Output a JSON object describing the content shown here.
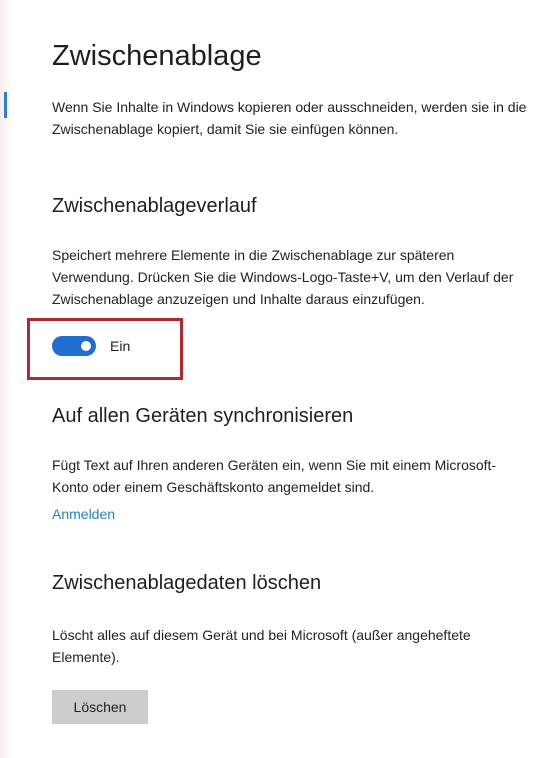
{
  "page": {
    "title": "Zwischenablage",
    "intro": "Wenn Sie Inhalte in Windows kopieren oder ausschneiden, werden sie in die Zwischenablage kopiert, damit Sie sie einfügen können."
  },
  "history": {
    "title": "Zwischenablageverlauf",
    "description": "Speichert mehrere Elemente in die Zwischenablage zur späteren Verwendung. Drücken Sie die Windows-Logo-Taste+V, um den Verlauf der Zwischenablage anzuzeigen und Inhalte daraus einzufügen.",
    "toggle_label": "Ein",
    "toggle_on": true
  },
  "sync": {
    "title": "Auf allen Geräten synchronisieren",
    "description": "Fügt Text auf Ihren anderen Geräten ein, wenn Sie mit einem Microsoft-Konto oder einem Geschäftskonto angemeldet sind.",
    "link_label": "Anmelden"
  },
  "clear": {
    "title": "Zwischenablagedaten löschen",
    "description": "Löscht alles auf diesem Gerät und bei Microsoft (außer angeheftete Elemente).",
    "button_label": "Löschen"
  },
  "colors": {
    "accent": "#1f6fd1",
    "link": "#2a7ec8",
    "highlight": "#b3282d",
    "button_bg": "#cccccc"
  }
}
